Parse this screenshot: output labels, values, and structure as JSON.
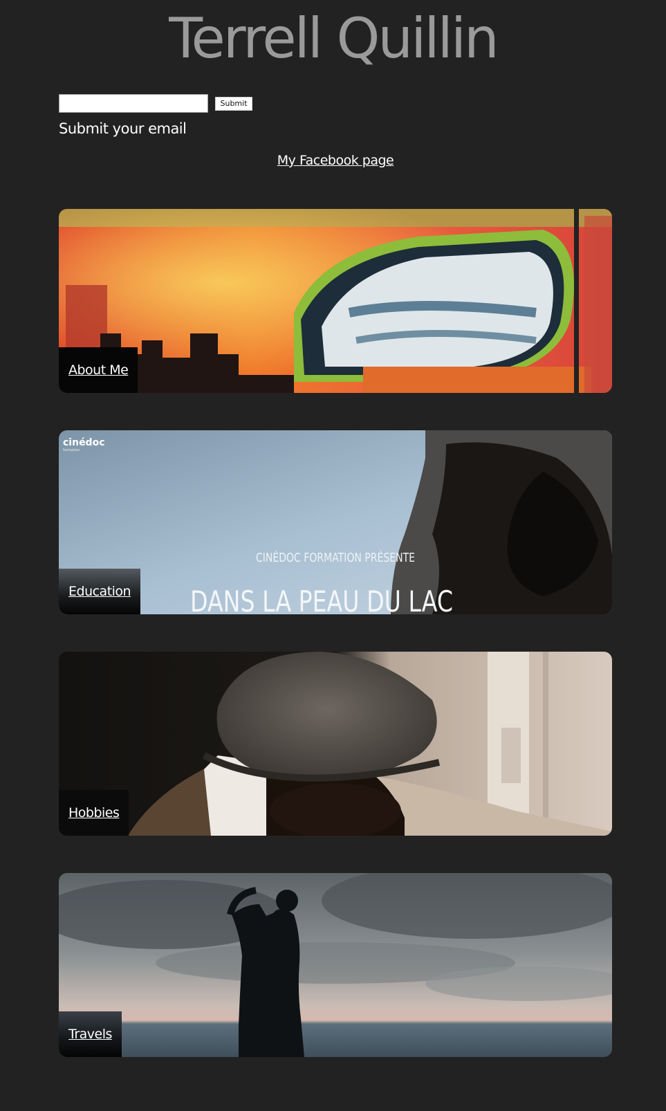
{
  "header": {
    "title": "Terrell Quillin"
  },
  "email_form": {
    "input_value": "",
    "submit_label": "Submit",
    "caption": "Submit your email"
  },
  "facebook": {
    "link_text": "My Facebook page"
  },
  "sections": [
    {
      "label": "About Me",
      "image": "graffiti-mural-image"
    },
    {
      "label": "Education",
      "image": "film-title-still-image",
      "logo_text": "cinédoc",
      "logo_sub": "formation",
      "overlay_line1": "CINÉDOC FORMATION PRÉSENTE",
      "overlay_line2": "DANS LA PEAU DU LAC"
    },
    {
      "label": "Hobbies",
      "image": "man-in-hat-image"
    },
    {
      "label": "Travels",
      "image": "seaside-silhouette-image"
    }
  ],
  "colors": {
    "background": "#222222",
    "title": "#9a9a9a",
    "text": "#ffffff"
  }
}
